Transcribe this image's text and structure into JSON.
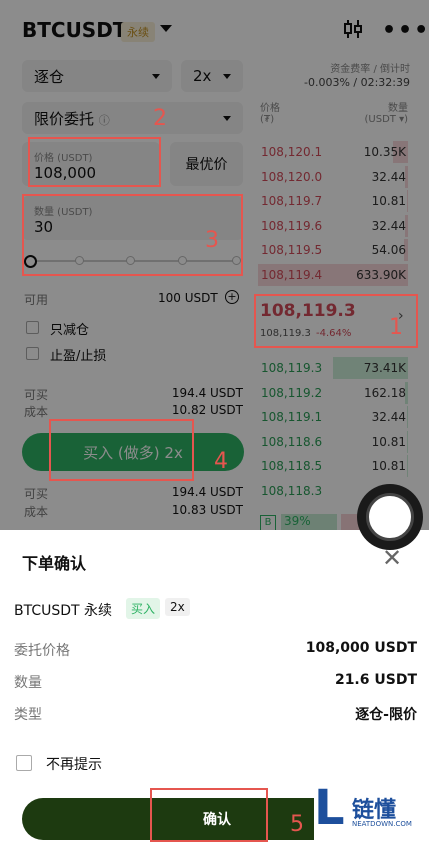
{
  "header": {
    "symbol": "BTCUSDT",
    "perp_badge": "永续"
  },
  "controls": {
    "margin_mode": "逐仓",
    "leverage": "2x",
    "order_type": "限价委托",
    "price_label": "价格 (USDT)",
    "price_value": "108,000",
    "best_price": "最优价",
    "qty_label": "数量 (USDT)",
    "qty_value": "30",
    "available_label": "可用",
    "available_value": "100 USDT",
    "reduce_only": "只减仓",
    "tp_sl": "止盈/止损",
    "can_buy_label": "可买",
    "can_buy_value": "194.4 USDT",
    "cost_label": "成本",
    "cost_value": "10.82 USDT",
    "buy_button": "买入 (做多) 2x",
    "can_buy_label2": "可买",
    "can_buy_value2": "194.4 USDT",
    "cost_label2": "成本",
    "cost_value2": "10.83 USDT"
  },
  "funding": {
    "label": "资金费率 / 倒计时",
    "value": "-0.003% / 02:32:39"
  },
  "orderbook": {
    "price_head": "价格",
    "price_unit": "(₮)",
    "qty_head": "数量",
    "qty_unit": "(USDT ▾)",
    "asks": [
      {
        "price": "108,120.1",
        "qty": "10.35K",
        "depth": 0.1
      },
      {
        "price": "108,120.0",
        "qty": "32.44",
        "depth": 0.02
      },
      {
        "price": "108,119.7",
        "qty": "10.81",
        "depth": 0.01
      },
      {
        "price": "108,119.6",
        "qty": "32.44",
        "depth": 0.02
      },
      {
        "price": "108,119.5",
        "qty": "54.06",
        "depth": 0.03
      },
      {
        "price": "108,119.4",
        "qty": "633.90K",
        "depth": 1.0
      }
    ],
    "mid_price": "108,119.3",
    "mid_sub": "108,119.3",
    "mid_change": "-4.64%",
    "bids": [
      {
        "price": "108,119.3",
        "qty": "73.41K",
        "depth": 0.5
      },
      {
        "price": "108,119.2",
        "qty": "162.18",
        "depth": 0.02
      },
      {
        "price": "108,119.1",
        "qty": "32.44",
        "depth": 0.01
      },
      {
        "price": "108,118.6",
        "qty": "10.81",
        "depth": 0.01
      },
      {
        "price": "108,118.5",
        "qty": "10.81",
        "depth": 0.01
      },
      {
        "price": "108,118.3",
        "qty": "",
        "depth": 0.0
      }
    ],
    "buy_ratio_letter": "B",
    "buy_ratio": "39%"
  },
  "sheet": {
    "title": "下单确认",
    "symbol": "BTCUSDT 永续",
    "side": "买入",
    "leverage": "2x",
    "price_label": "委托价格",
    "price_value": "108,000 USDT",
    "qty_label": "数量",
    "qty_value": "21.6 USDT",
    "type_label": "类型",
    "type_value": "逐仓-限价",
    "no_remind": "不再提示",
    "confirm": "确认"
  },
  "annotations": [
    "1",
    "2",
    "3",
    "4",
    "5"
  ],
  "watermark": {
    "logo": "L",
    "brand": "链懂",
    "site": "NEATDOWN.COM"
  },
  "colors": {
    "buy": "#2eb264",
    "sell": "#d24b5a",
    "annotation": "#e5564f",
    "confirm": "#1d3a10"
  }
}
